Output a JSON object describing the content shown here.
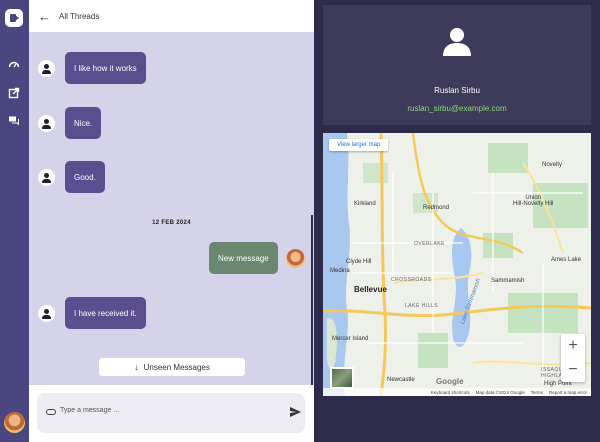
{
  "rail": {
    "icons": [
      "video-logo-icon",
      "dashboard-icon",
      "open-external-icon",
      "chat-icon"
    ]
  },
  "chat": {
    "back_label": "All Threads",
    "messages": [
      {
        "text": "I like how it works",
        "direction": "in"
      },
      {
        "text": "Nice.",
        "direction": "in"
      },
      {
        "text": "Good.",
        "direction": "in"
      },
      {
        "text": "New message",
        "direction": "out"
      },
      {
        "text": "I have received it.",
        "direction": "in"
      }
    ],
    "date_separator": "12 FEB 2024",
    "unseen_label": "Unseen Messages",
    "composer_placeholder": "Type a message ..."
  },
  "profile": {
    "name": "Ruslan Sirbu",
    "email": "ruslan_sirbu@example.com"
  },
  "map": {
    "view_larger": "View larger map",
    "places": {
      "kirkland": "Kirkland",
      "redmond": "Redmond",
      "novelty": "Novelty",
      "union_hill": "Union\nHill-Novelty Hill",
      "overlake": "OVERLAKE",
      "clyde_hill": "Clyde Hill",
      "medina": "Medina",
      "crossroads": "CROSSROADS",
      "ames_lake": "Ames Lake",
      "bellevue": "Bellevue",
      "sammamish": "Sammamish",
      "lake_hills": "LAKE HILLS",
      "lake_sammamish": "Lake Sammamish",
      "mercer_island": "Mercer Island",
      "newcastle": "Newcastle",
      "issaquah": "ISSAQUAH\nHIGHLANDS",
      "high_point": "High Point"
    },
    "zoom_in": "+",
    "zoom_out": "−",
    "logo": "Google",
    "attribution": [
      "Keyboard shortcuts",
      "Map data ©2024 Google",
      "Terms",
      "Report a map error"
    ]
  },
  "colors": {
    "rail": "#4a4680",
    "chat_bg": "#d5d3e9",
    "bubble_in": "#5a4e8f",
    "bubble_out": "#6a876f",
    "profile_bg": "#3d3a5a",
    "email": "#8fd67e",
    "page_bg": "#2d2a4a"
  }
}
